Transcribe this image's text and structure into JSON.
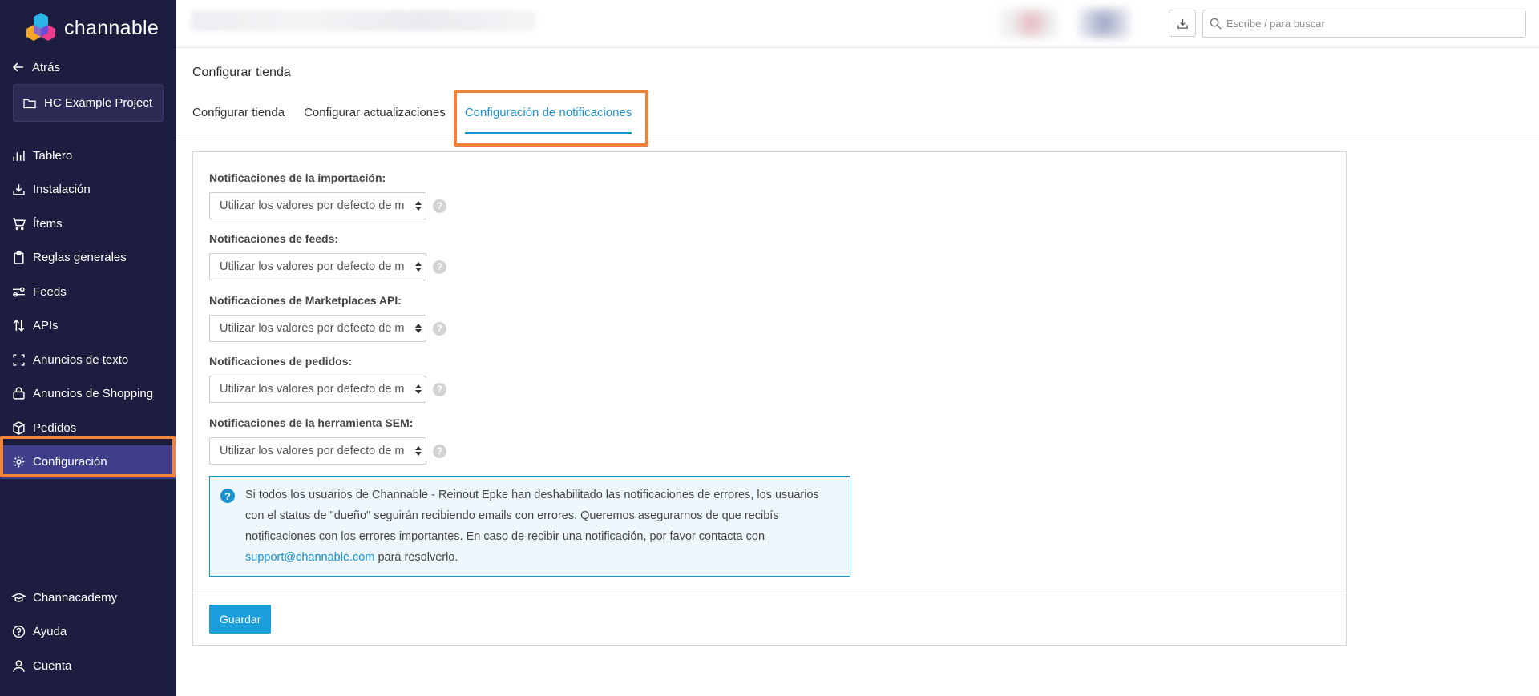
{
  "brand": {
    "name": "channable"
  },
  "sidebar": {
    "back_label": "Atrás",
    "project_name": "HC Example Project",
    "items": [
      {
        "label": "Tablero",
        "icon": "bar-chart-icon"
      },
      {
        "label": "Instalación",
        "icon": "download-tray-icon"
      },
      {
        "label": "Ítems",
        "icon": "cart-icon"
      },
      {
        "label": "Reglas generales",
        "icon": "clipboard-icon"
      },
      {
        "label": "Feeds",
        "icon": "feeds-icon"
      },
      {
        "label": "APIs",
        "icon": "up-down-arrows-icon"
      },
      {
        "label": "Anuncios de texto",
        "icon": "frame-corners-icon"
      },
      {
        "label": "Anuncios de Shopping",
        "icon": "shopping-bag-icon"
      },
      {
        "label": "Pedidos",
        "icon": "box-icon"
      },
      {
        "label": "Configuración",
        "icon": "gear-icon",
        "active": true
      }
    ],
    "bottom_items": [
      {
        "label": "Channacademy",
        "icon": "graduation-cap-icon"
      },
      {
        "label": "Ayuda",
        "icon": "question-circle-icon"
      },
      {
        "label": "Cuenta",
        "icon": "user-icon"
      }
    ]
  },
  "topbar": {
    "search_placeholder": "Escribe / para buscar"
  },
  "page": {
    "title": "Configurar tienda",
    "tabs": [
      {
        "label": "Configurar tienda"
      },
      {
        "label": "Configurar actualizaciones"
      },
      {
        "label": "Configuración de notificaciones",
        "active": true
      }
    ]
  },
  "form": {
    "fields": [
      {
        "label": "Notificaciones de la importación:",
        "value": "Utilizar los valores por defecto de m"
      },
      {
        "label": "Notificaciones de feeds:",
        "value": "Utilizar los valores por defecto de m"
      },
      {
        "label": "Notificaciones de Marketplaces API:",
        "value": "Utilizar los valores por defecto de m"
      },
      {
        "label": "Notificaciones de pedidos:",
        "value": "Utilizar los valores por defecto de m"
      },
      {
        "label": "Notificaciones de la herramienta SEM:",
        "value": "Utilizar los valores por defecto de m"
      }
    ],
    "help_glyph": "?",
    "info": {
      "icon_glyph": "?",
      "text": "Si todos los usuarios de Channable - Reinout Epke han deshabilitado las notificaciones de errores, los usuarios con el status de \"dueño\" seguirán recibiendo emails con errores. Queremos asegurarnos de que recibís notificaciones con los errores importantes. En caso de recibir una notificación, por favor contacta con ",
      "link": "support@channable.com",
      "text_after": " para resolverlo."
    },
    "save_label": "Guardar"
  },
  "colors": {
    "sidebar_bg": "#1d1d3f",
    "sidebar_active": "#3e3e8a",
    "accent": "#1a91d0",
    "highlight": "#f08338"
  }
}
